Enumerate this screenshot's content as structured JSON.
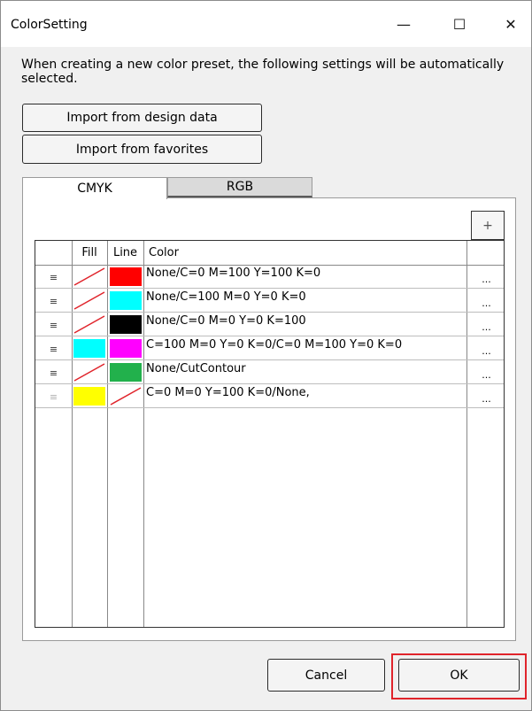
{
  "window": {
    "title": "ColorSetting",
    "minimize_glyph": "—",
    "maximize_glyph": "☐",
    "close_glyph": "✕"
  },
  "description": "When creating a new color preset, the following settings will be automatically selected.",
  "buttons": {
    "import_design": "Import from design data",
    "import_favorites": "Import from favorites",
    "add": "+",
    "cancel": "Cancel",
    "ok": "OK"
  },
  "tabs": [
    {
      "label": "CMYK",
      "selected": true
    },
    {
      "label": "RGB",
      "selected": false
    }
  ],
  "table": {
    "headers": {
      "handle": "",
      "fill": "Fill",
      "line": "Line",
      "color": "Color",
      "more": ""
    },
    "rows": [
      {
        "handle": "≡",
        "fill": "none",
        "line": "#ff0000",
        "color": "None/C=0 M=100 Y=100 K=0",
        "more": "...",
        "dim": false
      },
      {
        "handle": "≡",
        "fill": "none",
        "line": "#00ffff",
        "color": "None/C=100 M=0 Y=0 K=0",
        "more": "...",
        "dim": false
      },
      {
        "handle": "≡",
        "fill": "none",
        "line": "#000000",
        "color": "None/C=0 M=0 Y=0 K=100",
        "more": "...",
        "dim": false
      },
      {
        "handle": "≡",
        "fill": "#00ffff",
        "line": "#ff00ff",
        "color": "C=100 M=0 Y=0 K=0/C=0 M=100 Y=0 K=0",
        "more": "...",
        "dim": false
      },
      {
        "handle": "≡",
        "fill": "none",
        "line": "#22b14c",
        "color": "None/CutContour",
        "more": "...",
        "dim": false
      },
      {
        "handle": "≡",
        "fill": "#ffff00",
        "line": "none",
        "color": "C=0 M=0 Y=100 K=0/None,",
        "more": "...",
        "dim": true
      }
    ]
  },
  "colors": {
    "highlight": "#e0242b",
    "none_slash": "#e0242b"
  }
}
